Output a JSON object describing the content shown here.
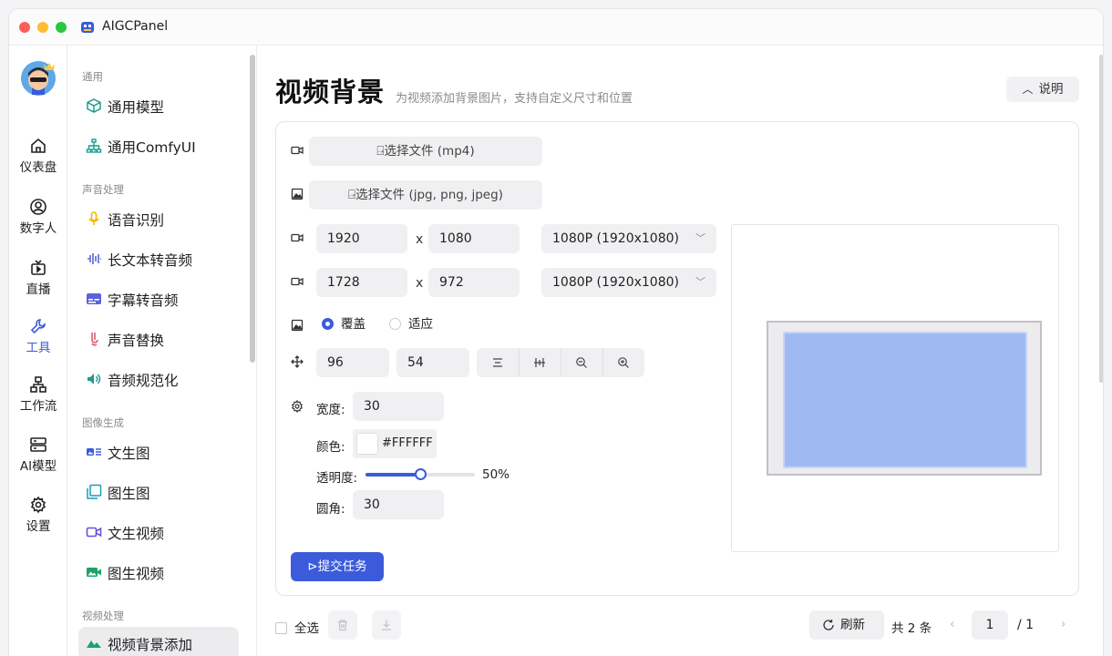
{
  "app": {
    "title": "AIGCPanel"
  },
  "rail": [
    {
      "label": "仪表盘",
      "icon": "home-icon"
    },
    {
      "label": "数字人",
      "icon": "user-circle-icon"
    },
    {
      "label": "直播",
      "icon": "tv-icon"
    },
    {
      "label": "工具",
      "icon": "wrench-icon",
      "active": true
    },
    {
      "label": "工作流",
      "icon": "workflow-icon"
    },
    {
      "label": "AI模型",
      "icon": "server-icon"
    },
    {
      "label": "设置",
      "icon": "gear-icon"
    }
  ],
  "menu": {
    "groups": [
      "通用",
      "声音处理",
      "图像生成",
      "视频处理"
    ],
    "items": [
      "通用模型",
      "通用ComfyUI",
      "语音识别",
      "长文本转音频",
      "字幕转音频",
      "声音替换",
      "音频规范化",
      "文生图",
      "图生图",
      "文生视频",
      "图生视频",
      "视频背景添加"
    ]
  },
  "page": {
    "title": "视频背景",
    "subtitle": "为视频添加背景图片，支持自定义尺寸和位置",
    "help_label": "说明"
  },
  "form": {
    "video_file_label": "选择文件 (mp4)",
    "image_file_label": "选择文件 (jpg, png, jpeg)",
    "bg_width": "1920",
    "bg_height": "1080",
    "bg_preset": "1080P (1920x1080)",
    "video_width": "1728",
    "video_height": "972",
    "video_preset": "1080P (1920x1080)",
    "x_sep": "x",
    "fit_options": [
      "覆盖",
      "适应"
    ],
    "pos_x": "96",
    "pos_y": "54",
    "border_width_label": "宽度:",
    "border_width": "30",
    "color_label": "颜色:",
    "color_value": "#FFFFFF",
    "opacity_label": "透明度:",
    "opacity_value": "50%",
    "opacity": 0.5,
    "radius_label": "圆角:",
    "radius": "30",
    "submit_label": "提交任务"
  },
  "list": {
    "select_all": "全选",
    "refresh": "刷新",
    "total": "共 2 条",
    "page": "1",
    "page_total": "/ 1"
  },
  "colors": {
    "accent": "#3b5bdb",
    "preview_fill": "#9fbaf2"
  }
}
